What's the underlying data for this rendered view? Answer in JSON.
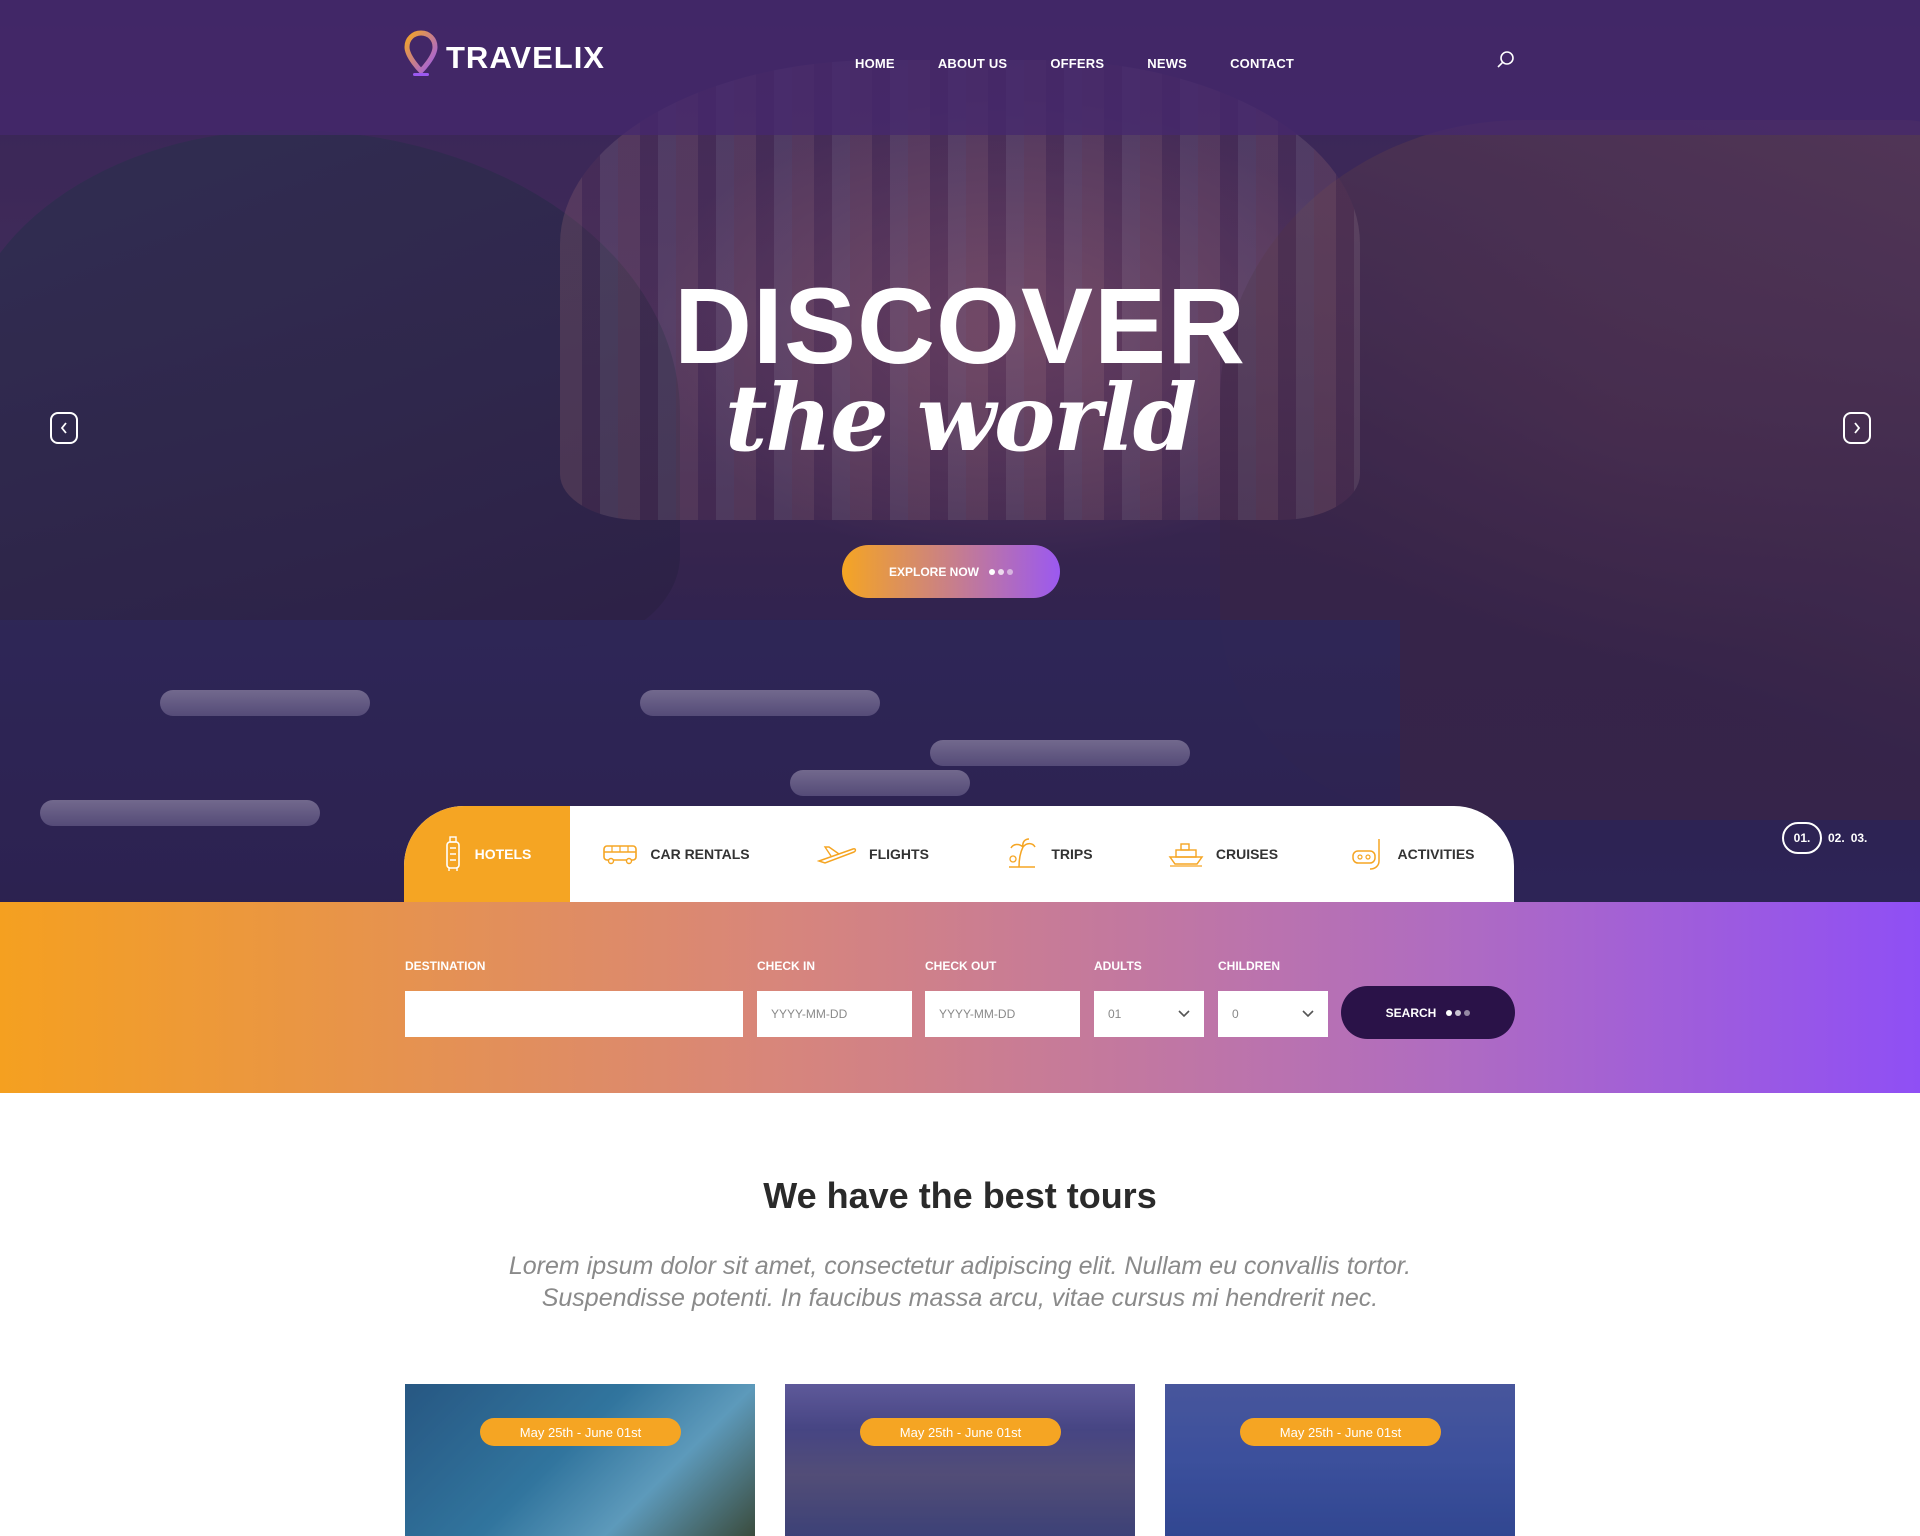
{
  "brand": {
    "name": "TRAVELIX"
  },
  "nav": {
    "items": [
      "HOME",
      "ABOUT US",
      "OFFERS",
      "NEWS",
      "CONTACT"
    ]
  },
  "hero": {
    "headline": "DISCOVER",
    "subheadline": "the world",
    "cta": "EXPLORE NOW",
    "pager": {
      "active": "01.",
      "others": [
        "02.",
        "03."
      ]
    }
  },
  "tabs": [
    {
      "label": "HOTELS",
      "icon": "hotel-icon",
      "active": true
    },
    {
      "label": "CAR RENTALS",
      "icon": "bus-icon",
      "active": false
    },
    {
      "label": "FLIGHTS",
      "icon": "plane-icon",
      "active": false
    },
    {
      "label": "TRIPS",
      "icon": "island-icon",
      "active": false
    },
    {
      "label": "CRUISES",
      "icon": "ship-icon",
      "active": false
    },
    {
      "label": "ACTIVITIES",
      "icon": "snorkel-icon",
      "active": false
    }
  ],
  "search_form": {
    "destination": {
      "label": "DESTINATION",
      "value": "",
      "placeholder": ""
    },
    "check_in": {
      "label": "CHECK IN",
      "placeholder": "YYYY-MM-DD"
    },
    "check_out": {
      "label": "CHECK OUT",
      "placeholder": "YYYY-MM-DD"
    },
    "adults": {
      "label": "ADULTS",
      "value": "01"
    },
    "children": {
      "label": "CHILDREN",
      "value": "0"
    },
    "submit": "SEARCH"
  },
  "section": {
    "title": "We have the best tours",
    "lead_line1": "Lorem ipsum dolor sit amet, consectetur adipiscing elit. Nullam eu convallis tortor.",
    "lead_line2": "Suspendisse potenti. In faucibus massa arcu, vitae cursus mi hendrerit nec."
  },
  "tours": [
    {
      "dates": "May 25th - June 01st"
    },
    {
      "dates": "May 25th - June 01st"
    },
    {
      "dates": "May 25th - June 01st"
    }
  ],
  "colors": {
    "accent_orange": "#f5a523",
    "accent_purple": "#8f4ff5",
    "dark": "#2a1248"
  }
}
